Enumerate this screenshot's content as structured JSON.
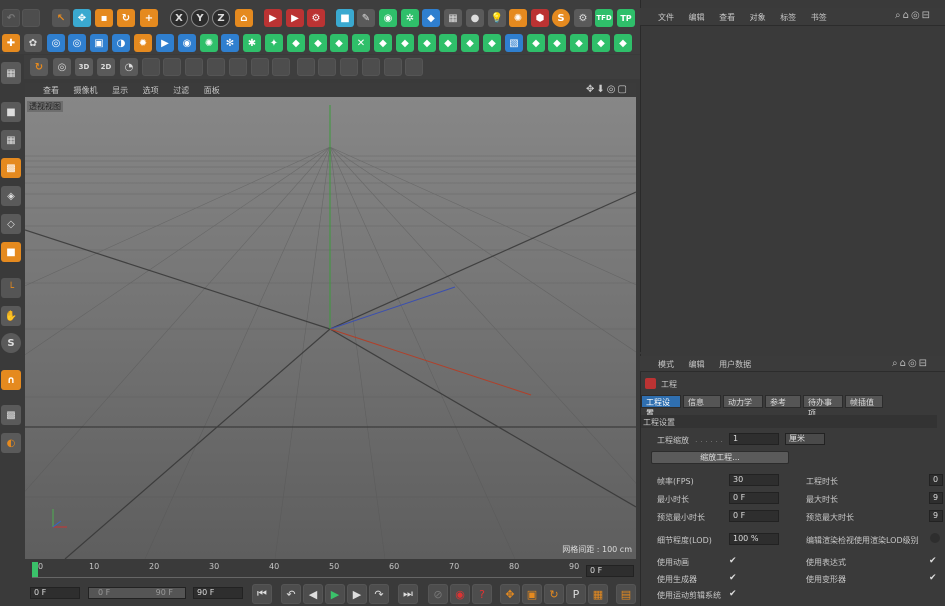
{
  "top_menu": [
    "文件",
    "编辑",
    "查看",
    "对象",
    "标签",
    "书签"
  ],
  "viewport": {
    "menu": [
      "查看",
      "摄像机",
      "显示",
      "选项",
      "过滤",
      "面板"
    ],
    "label": "透视视图",
    "grid_info": "网格间距 : 100 cm"
  },
  "attr": {
    "menu": [
      "模式",
      "编辑",
      "用户数据"
    ],
    "title": "工程",
    "tabs": [
      "工程设置",
      "信息",
      "动力学",
      "参考",
      "待办事项",
      "帧插值"
    ],
    "section": "工程设置",
    "scale_label": "工程缩放",
    "scale_value": "1",
    "scale_unit": "厘米",
    "scale_button": "缩放工程...",
    "fps_label": "帧率(FPS)",
    "fps_value": "30",
    "duration_label": "工程时长",
    "min_label": "最小时长",
    "min_value": "0 F",
    "max_label": "最大时长",
    "pmin_label": "预览最小时长",
    "pmin_value": "0 F",
    "pmax_label": "预览最大时长",
    "lod_label": "细节程度(LOD)",
    "lod_value": "100 %",
    "lod_editor_label": "编辑渲染检视使用渲染LOD级别",
    "anim_label": "使用动画",
    "expr_label": "使用表达式",
    "gen_label": "使用生成器",
    "deform_label": "使用变形器",
    "motion_label": "使用运动剪辑系统",
    "partial_values": [
      "0",
      "9",
      "9"
    ]
  },
  "timeline": {
    "ticks": [
      "0",
      "10",
      "20",
      "30",
      "40",
      "50",
      "60",
      "70",
      "80",
      "90"
    ],
    "frame_end": "0 F",
    "start": "0 F",
    "range_start": "0 F",
    "range_end": "90 F",
    "end": "90 F"
  },
  "top_icons_text": {
    "x": "X",
    "y": "Y",
    "z": "Z",
    "tfd": "TFD",
    "tp": "TP",
    "s": "S",
    "three_d": "3D",
    "two_d": "2D"
  }
}
